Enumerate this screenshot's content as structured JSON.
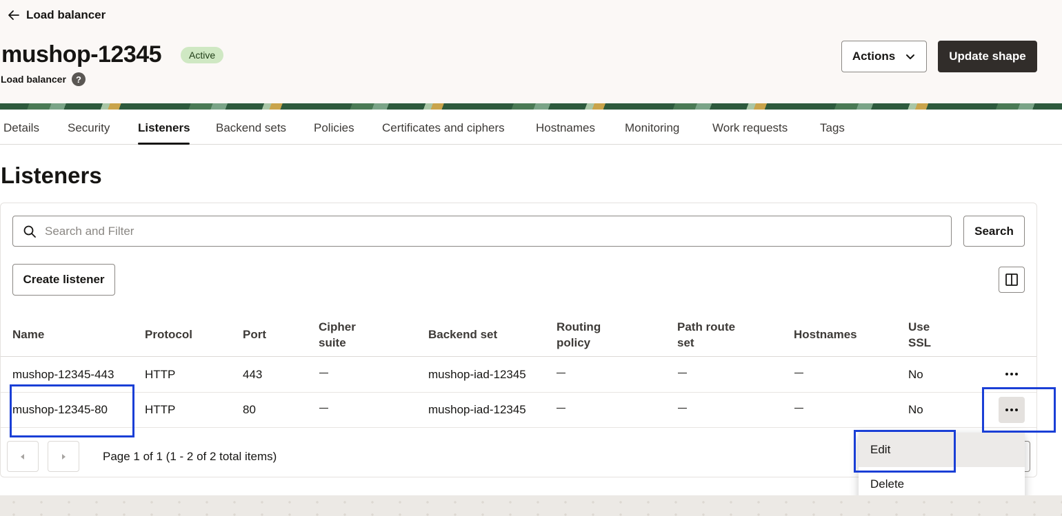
{
  "header": {
    "back_label": "Load balancer",
    "title": "mushop-12345",
    "status": "Active",
    "subtitle": "Load balancer",
    "help_glyph": "?",
    "actions_label": "Actions",
    "update_label": "Update shape"
  },
  "tabs": [
    {
      "label": "Details"
    },
    {
      "label": "Security"
    },
    {
      "label": "Listeners"
    },
    {
      "label": "Backend sets"
    },
    {
      "label": "Policies"
    },
    {
      "label": "Certificates and ciphers"
    },
    {
      "label": "Hostnames"
    },
    {
      "label": "Monitoring"
    },
    {
      "label": "Work requests"
    },
    {
      "label": "Tags"
    }
  ],
  "active_tab": "Listeners",
  "section": {
    "title": "Listeners",
    "search_placeholder": "Search and Filter",
    "search_button": "Search",
    "create_button": "Create listener"
  },
  "table": {
    "columns": [
      {
        "line1": "Name",
        "line2": ""
      },
      {
        "line1": "Protocol",
        "line2": ""
      },
      {
        "line1": "Port",
        "line2": ""
      },
      {
        "line1": "Cipher",
        "line2": "suite"
      },
      {
        "line1": "Backend set",
        "line2": ""
      },
      {
        "line1": "Routing",
        "line2": "policy"
      },
      {
        "line1": "Path route",
        "line2": "set"
      },
      {
        "line1": "Hostnames",
        "line2": ""
      },
      {
        "line1": "Use",
        "line2": "SSL"
      }
    ],
    "rows": [
      {
        "name": "mushop-12345-443",
        "protocol": "HTTP",
        "port": "443",
        "backend_set": "mushop-iad-12345",
        "use_ssl": "No"
      },
      {
        "name": "mushop-12345-80",
        "protocol": "HTTP",
        "port": "80",
        "backend_set": "mushop-iad-12345",
        "use_ssl": "No"
      }
    ]
  },
  "pagination": {
    "text": "Page 1 of 1 (1 - 2 of 2 total items)"
  },
  "context_menu": {
    "items": [
      {
        "label": "Edit"
      },
      {
        "label": "Delete"
      }
    ]
  },
  "colors": {
    "highlight": "#1a3fd6",
    "badge_bg": "#cfe8c3",
    "primary_button": "#312d2a"
  }
}
